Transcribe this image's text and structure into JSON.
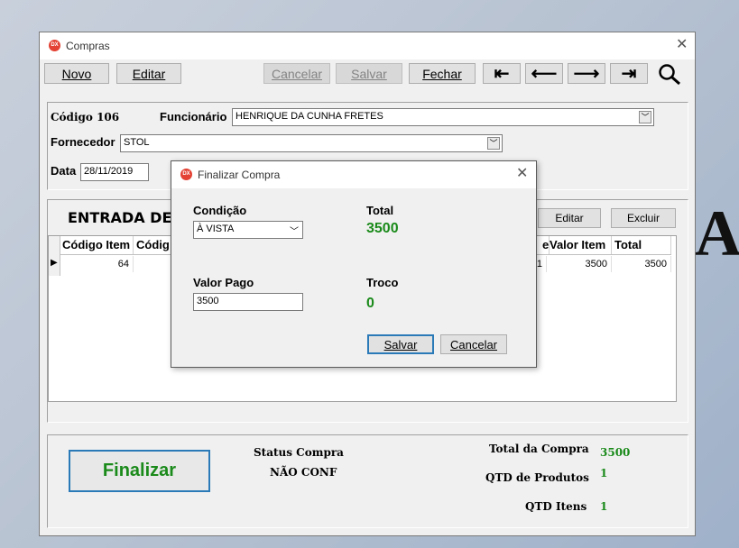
{
  "background_text": "A",
  "main_window": {
    "title": "Compras",
    "icon_text": "DX",
    "toolbar": {
      "novo": "Novo",
      "editar": "Editar",
      "cancelar": "Cancelar",
      "salvar": "Salvar",
      "fechar": "Fechar"
    },
    "header": {
      "codigo_label": "Código 106",
      "funcionario_label": "Funcionário",
      "funcionario_value": "HENRIQUE DA CUNHA FRETES",
      "fornecedor_label": "Fornecedor",
      "fornecedor_value": "STOL",
      "data_label": "Data",
      "data_value": "28/11/2019"
    },
    "items": {
      "section_title": "ENTRADA DE I",
      "editar_label": "Editar",
      "excluir_label": "Excluir",
      "columns": [
        "Código Item",
        "Códig",
        "e",
        "Valor Item",
        "Total"
      ],
      "rows": [
        {
          "codigo_item": "64",
          "qtd": "1",
          "valor_item": "3500",
          "total": "3500"
        }
      ]
    },
    "footer": {
      "finalizar_label": "Finalizar",
      "status_label": "Status Compra",
      "status_value": "NÃO CONF",
      "total_compra_label": "Total da Compra",
      "total_compra_value": "3500",
      "qtd_produtos_label": "QTD de Produtos",
      "qtd_produtos_value": "1",
      "qtd_itens_label": "QTD Itens",
      "qtd_itens_value": "1"
    }
  },
  "dialog": {
    "title": "Finalizar Compra",
    "icon_text": "DX",
    "condicao_label": "Condição",
    "condicao_value": "À VISTA",
    "total_label": "Total",
    "total_value": "3500",
    "valor_pago_label": "Valor Pago",
    "valor_pago_value": "3500",
    "troco_label": "Troco",
    "troco_value": "0",
    "salvar_label": "Salvar",
    "cancelar_label": "Cancelar"
  },
  "colors": {
    "accent_green": "#1a8a1a",
    "focus_blue": "#2a7ab8",
    "icon_red": "#e34234"
  },
  "icons": [
    "first-record-icon",
    "previous-record-icon",
    "next-record-icon",
    "last-record-icon",
    "search-icon",
    "close-icon",
    "combo-arrow-icon",
    "row-pointer-icon"
  ]
}
